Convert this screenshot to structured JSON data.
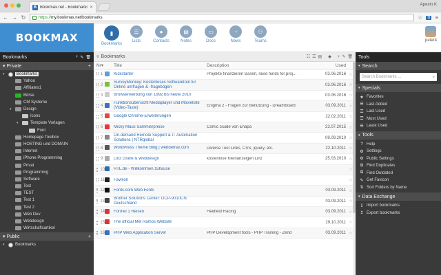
{
  "browser": {
    "tab_title": "Bookmax.net - Bookmarks",
    "tab_favicon": "B",
    "user": "Apextn K",
    "url_scheme": "https://",
    "url_rest": "my.bookmax.net/bookmarks"
  },
  "app": {
    "logo": "BOOKMAX",
    "nav": [
      {
        "label": "Bookmarks",
        "icon": "bookmarks-icon"
      },
      {
        "label": "Lists",
        "icon": "lists-icon"
      },
      {
        "label": "Contacts",
        "icon": "contacts-icon"
      },
      {
        "label": "Notes",
        "icon": "notes-icon"
      },
      {
        "label": "Docs",
        "icon": "docs-icon"
      },
      {
        "label": "News",
        "icon": "news-icon"
      },
      {
        "label": "Teams",
        "icon": "teams-icon"
      }
    ],
    "username": "peter4"
  },
  "left": {
    "title": "Bookmarks",
    "private_label": "Private",
    "public_label": "Public",
    "tree": [
      {
        "label": "Bookmarks",
        "depth": 0,
        "kind": "root",
        "selected": true
      },
      {
        "label": "Yahoo",
        "depth": 1,
        "kind": "folder"
      },
      {
        "label": "Affiliates1",
        "depth": 1,
        "kind": "folder"
      },
      {
        "label": "Börse",
        "depth": 1,
        "kind": "green"
      },
      {
        "label": "CM Systeme",
        "depth": 1,
        "kind": "folder"
      },
      {
        "label": "Design",
        "depth": 1,
        "kind": "folder",
        "open": true
      },
      {
        "label": "Icons",
        "depth": 2,
        "kind": "light"
      },
      {
        "label": "Template Vorlagen",
        "depth": 2,
        "kind": "light",
        "open": true
      },
      {
        "label": "Font",
        "depth": 3,
        "kind": "light"
      },
      {
        "label": "Homepage Toolbox",
        "depth": 1,
        "kind": "folder"
      },
      {
        "label": "HOSTING und DOMAIN",
        "depth": 1,
        "kind": "folder"
      },
      {
        "label": "Internet",
        "depth": 1,
        "kind": "folder"
      },
      {
        "label": "iPhone Programming",
        "depth": 1,
        "kind": "folder"
      },
      {
        "label": "Privat",
        "depth": 1,
        "kind": "folder"
      },
      {
        "label": "Programming",
        "depth": 1,
        "kind": "folder"
      },
      {
        "label": "Software",
        "depth": 1,
        "kind": "folder"
      },
      {
        "label": "Test",
        "depth": 1,
        "kind": "folder"
      },
      {
        "label": "TEST",
        "depth": 1,
        "kind": "folder"
      },
      {
        "label": "Test 1",
        "depth": 1,
        "kind": "folder"
      },
      {
        "label": "Test 2",
        "depth": 1,
        "kind": "folder"
      },
      {
        "label": "Web Dev",
        "depth": 1,
        "kind": "folder"
      },
      {
        "label": "Webdesign",
        "depth": 1,
        "kind": "folder"
      },
      {
        "label": "Wirtschaftsartikel",
        "depth": 1,
        "kind": "folder"
      }
    ],
    "public_tree": [
      {
        "label": "Bookmarks",
        "depth": 0,
        "kind": "root"
      }
    ]
  },
  "main": {
    "title": "Bookmarks",
    "columns": {
      "nr": "Nr",
      "title": "Title",
      "desc": "Description",
      "used": "Used"
    },
    "rows": [
      {
        "nr": "1",
        "title": "Kickstarter",
        "desc": "Projekte finanzieren lassen, raise funds for proj...",
        "used": "03.06.2016",
        "color": "#5aa0e0"
      },
      {
        "nr": "2",
        "title": "SurveyMonkey: Kostenloses Softwaretool für Online umfragen & -fragebögen",
        "desc": "",
        "used": "03.06.2016",
        "color": "#7bbf3a"
      },
      {
        "nr": "3",
        "title": "Browserwerbung von 1992 bis heute 2010",
        "desc": "",
        "used": "03.06.2016",
        "color": "#cccccc"
      },
      {
        "nr": "4",
        "title": "Funktionsübersicht Mediaplayer und Movieliste (Video-Taste)",
        "desc": "Enigma 2 - Fragen zur Benutzung - Dreamboard",
        "used": "03.09.2011",
        "color": "#3a6fc4"
      },
      {
        "nr": "5",
        "title": "Google Chrome-Erweiterungen",
        "desc": "",
        "used": "22.02.2011",
        "color": "#dd4b39"
      },
      {
        "nr": "6",
        "title": "Micky Maus Sammlerpreise",
        "desc": "Comic Guide von Ehapa",
        "used": "23.07.2015",
        "color": "#e33"
      },
      {
        "nr": "7",
        "title": "On-demand Remote Support & IT Automation Solutions | NTRglobal",
        "desc": "",
        "used": "09.09.2010",
        "color": "#888888"
      },
      {
        "nr": "8",
        "title": "WordPress Theme Blog | webdemar.com",
        "desc": "Diverse Tool Links, CSS, jquery, etc.",
        "used": "22.10.2011",
        "color": "#555555"
      },
      {
        "nr": "9",
        "title": "Linz Grafik & Webdesign",
        "desc": "kostenlose Kleinanzeigen Linz",
        "used": "25.03.2010",
        "color": "#aaaaaa"
      },
      {
        "nr": "10",
        "title": "RTL.de - Willkommen zuhause",
        "desc": "",
        "used": "",
        "color": "#2b6cb3"
      },
      {
        "nr": "11",
        "title": "Favikon",
        "desc": "",
        "used": "",
        "color": "#222222"
      },
      {
        "nr": "12",
        "title": "Fonts.com Web Fonts",
        "desc": "",
        "used": "03.09.2011",
        "color": "#111111"
      },
      {
        "nr": "13",
        "title": "Brother Solutions Center: DCP-9010CN: Deutschland",
        "desc": "",
        "used": "03.09.2011",
        "color": "#444444"
      },
      {
        "nr": "14",
        "title": "Formel 1 Reisen",
        "desc": "Heidfeld Racing",
        "used": "03.09.2011",
        "color": "#d33"
      },
      {
        "nr": "15",
        "title": "The official Mel Ramos Website",
        "desc": "",
        "used": "29.10.2011",
        "color": "#d33"
      },
      {
        "nr": "16",
        "title": "PHP Web Application Server",
        "desc": "PHP Development tools - PHP Training - Zend",
        "used": "03.09.2011",
        "color": "#3a6fc4"
      }
    ]
  },
  "right": {
    "tools_title": "Tools",
    "search_label": "Search",
    "search_placeholder": "Search Bookmarks ...",
    "specials_label": "Specials",
    "specials": [
      {
        "label": "Favorites",
        "icon": "star-icon",
        "glyph": "★"
      },
      {
        "label": "Last Added",
        "icon": "list-icon",
        "glyph": "☰"
      },
      {
        "label": "Last Used",
        "icon": "list-icon",
        "glyph": "☰"
      },
      {
        "label": "Most Used",
        "icon": "list-icon",
        "glyph": "☰"
      },
      {
        "label": "Least Used",
        "icon": "list-icon",
        "glyph": "☰"
      }
    ],
    "tools_label": "Tools",
    "tools": [
      {
        "label": "Help",
        "icon": "help-icon",
        "glyph": "?"
      },
      {
        "label": "Settings",
        "icon": "gear-icon",
        "glyph": "⚙"
      },
      {
        "label": "Public Settings",
        "icon": "gear-icon",
        "glyph": "⚙"
      },
      {
        "label": "Find Duplicates",
        "icon": "find-icon",
        "glyph": "⧉"
      },
      {
        "label": "Find Outdated",
        "icon": "find-icon",
        "glyph": "⧉"
      },
      {
        "label": "Get Favicon",
        "icon": "favicon-icon",
        "glyph": "✎"
      },
      {
        "label": "Sort Folders by Name",
        "icon": "sort-icon",
        "glyph": "⇅"
      }
    ],
    "exchange_label": "Data Exchange",
    "exchange": [
      {
        "label": "Import bookmarks",
        "icon": "import-icon",
        "glyph": "↧"
      },
      {
        "label": "Export bookmarks",
        "icon": "export-icon",
        "glyph": "↥"
      }
    ]
  },
  "colors": {
    "brand": "#3f8ed2",
    "panel": "#3a3a3a",
    "link": "#2b6cb3"
  }
}
